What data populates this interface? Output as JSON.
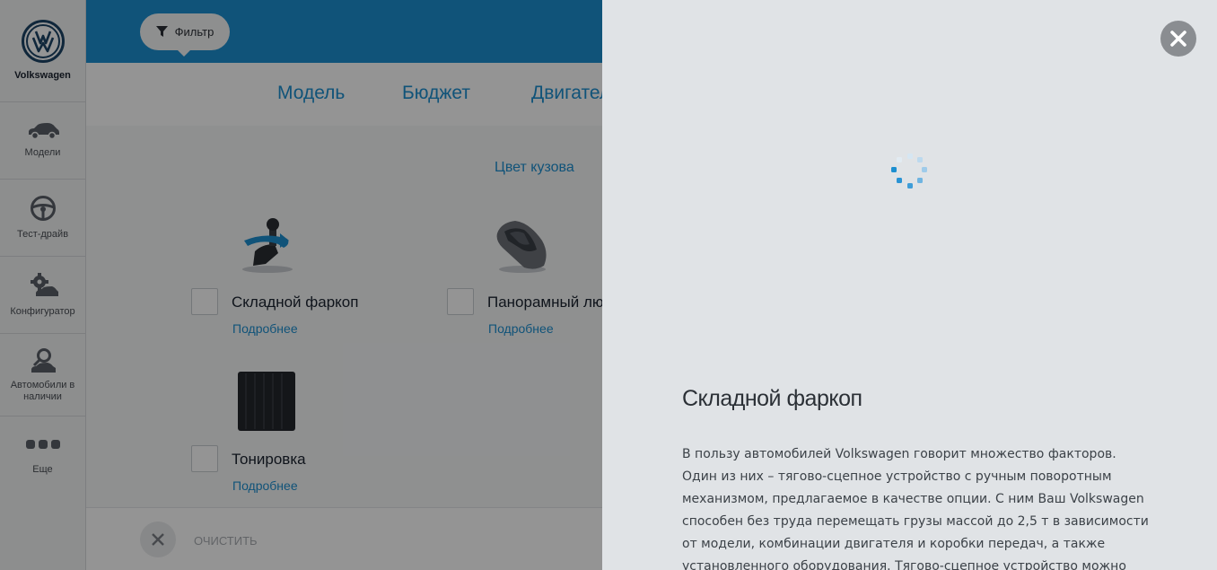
{
  "sidebar": {
    "brand": "Volkswagen",
    "items": [
      {
        "label": "Модели",
        "icon": "car-icon"
      },
      {
        "label": "Тест-драйв",
        "icon": "steering-wheel-icon"
      },
      {
        "label": "Конфигуратор",
        "icon": "configurator-gear-car-icon"
      },
      {
        "label": "Автомобили в наличии",
        "icon": "search-car-icon"
      },
      {
        "label": "Еще",
        "icon": "more-dots-icon"
      }
    ]
  },
  "topbar": {
    "filter_label": "Фильтр"
  },
  "tabs": [
    "Модель",
    "Бюджет",
    "Двигатель"
  ],
  "section_title": "Цвет кузова",
  "options": [
    {
      "title": "Складной фаркоп",
      "more": "Подробнее",
      "icon": "towbar-icon"
    },
    {
      "title": "Панорамный люк",
      "more": "Подробнее",
      "icon": "panoramic-roof-car-icon"
    },
    {
      "title": "Тонировка",
      "more": "Подробнее",
      "icon": "tinted-glass-icon"
    }
  ],
  "bottombar": {
    "clear_label": "ОЧИСТИТЬ"
  },
  "panel": {
    "title": "Складной фаркоп",
    "text": "В пользу автомобилей Volkswagen говорит множество факторов. Один из них – тягово-сцепное устройство с ручным поворотным механизмом, предлагаемое в качестве опции. С ним Ваш Volkswagen способен без труда перемещать грузы массой до 2,5 т в зависимости от модели, комбинации двигателя и коробки передач, а также установленного оборудования. Тягово-сцепное устройство можно"
  },
  "colors": {
    "accent": "#1d8fd0",
    "panel_bg": "#e0e3e6",
    "close_bg": "#8a8d91"
  }
}
